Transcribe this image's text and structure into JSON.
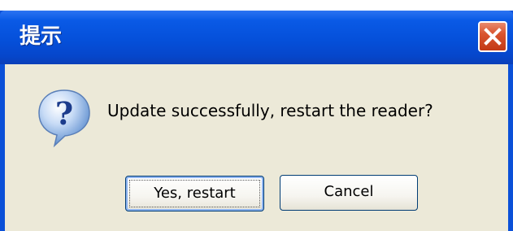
{
  "dialog": {
    "title": "提示",
    "message": "Update successfully, restart the reader?",
    "icon": "question-icon"
  },
  "buttons": {
    "yes_label": "Yes, restart",
    "cancel_label": "Cancel",
    "close_icon": "close-icon"
  },
  "colors": {
    "titlebar": "#0550da",
    "close_button": "#d9542f",
    "dialog_background": "#ece9d8"
  }
}
